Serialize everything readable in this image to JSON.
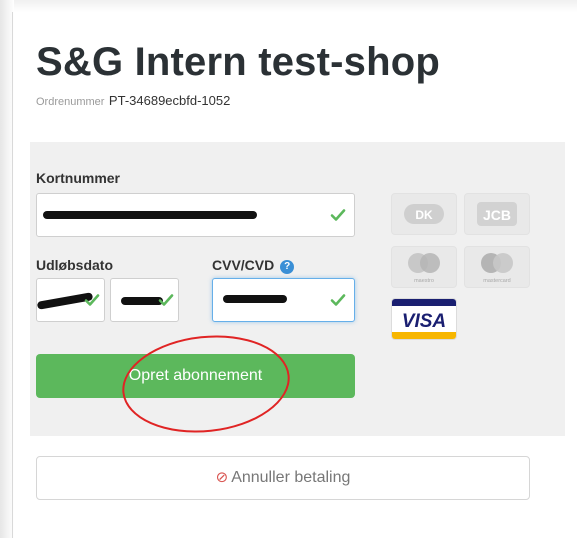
{
  "shop": {
    "title": "S&G Intern test-shop",
    "order_label": "Ordrenummer",
    "order_number": "PT-34689ecbfd-1052"
  },
  "form": {
    "card_number_label": "Kortnummer",
    "expiry_label": "Udløbsdato",
    "cvv_label": "CVV/CVD",
    "help_icon": "?"
  },
  "card_logos": {
    "visa_label": "VISA",
    "maestro_label": "maestro",
    "mastercard_label": "mastercard",
    "jcb_label": "JCB",
    "dankort_label": "DK"
  },
  "buttons": {
    "submit_label": "Opret abonnement",
    "cancel_label": "Annuller betaling",
    "cancel_icon": "⊘"
  },
  "colors": {
    "submit": "#5cb85c",
    "cancel_icon": "#d9534f",
    "focus_border": "#66afe9",
    "check": "#5cb85c",
    "annotation": "#e02424"
  }
}
